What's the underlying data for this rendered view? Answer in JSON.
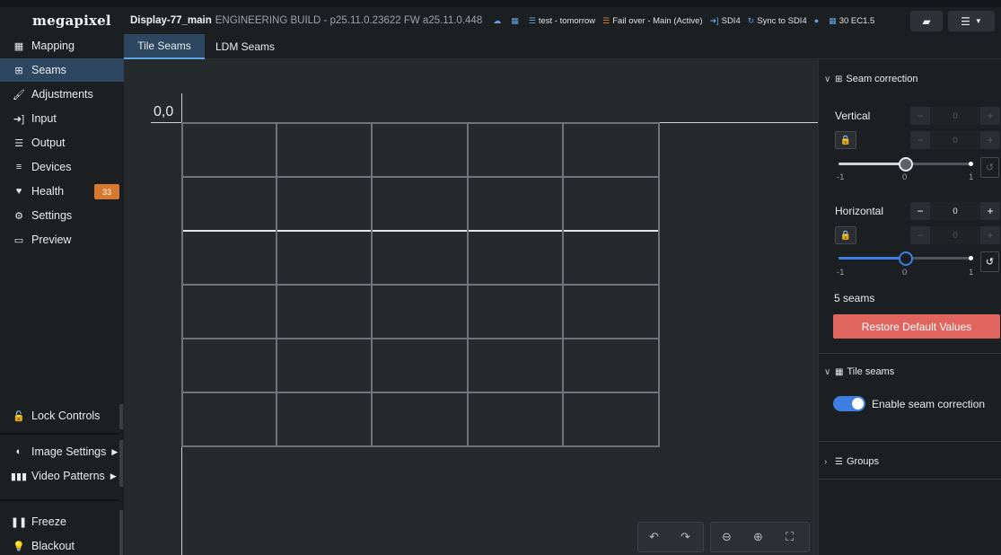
{
  "app": {
    "logo": "megapixel",
    "display_name": "Display-77_main",
    "build": "ENGINEERING BUILD - p25.11.0.23622 FW a25.11.0.448"
  },
  "status": {
    "schedule": "test - tomorrow",
    "failover": "Fail over - Main (Active)",
    "input": "SDI4",
    "sync": "Sync to SDI4",
    "framerate": "30 EC1.5"
  },
  "sidebar": {
    "items": [
      {
        "label": "Mapping",
        "icon": "grid-icon"
      },
      {
        "label": "Seams",
        "icon": "plus-box-icon"
      },
      {
        "label": "Adjustments",
        "icon": "brush-icon"
      },
      {
        "label": "Input",
        "icon": "input-icon"
      },
      {
        "label": "Output",
        "icon": "sliders-icon"
      },
      {
        "label": "Devices",
        "icon": "list-icon"
      },
      {
        "label": "Health",
        "icon": "heart-pulse-icon",
        "badge": "33"
      },
      {
        "label": "Settings",
        "icon": "gears-icon"
      },
      {
        "label": "Preview",
        "icon": "monitor-icon"
      }
    ],
    "lock_controls": "Lock Controls",
    "image_settings": "Image Settings",
    "video_patterns": "Video Patterns",
    "freeze": "Freeze",
    "blackout": "Blackout"
  },
  "tabs": {
    "tile_seams": "Tile Seams",
    "ldm_seams": "LDM Seams"
  },
  "canvas": {
    "origin_label": "0,0"
  },
  "panel": {
    "seam_correction": {
      "title": "Seam correction",
      "vertical_label": "Vertical",
      "vertical_value": "0",
      "vertical_locked_value": "0",
      "vertical_slider": {
        "min": "-1",
        "mid": "0",
        "max": "1",
        "value": 0
      },
      "horizontal_label": "Horizontal",
      "horizontal_value": "0",
      "horizontal_locked_value": "0",
      "horizontal_slider": {
        "min": "-1",
        "mid": "0",
        "max": "1",
        "value": 0
      },
      "seams_count": "5 seams",
      "restore_button": "Restore Default Values"
    },
    "tile_seams": {
      "title": "Tile seams",
      "enable_label": "Enable seam correction",
      "enabled": true
    },
    "groups": {
      "title": "Groups"
    }
  },
  "colors": {
    "accent_blue": "#3d7ee0",
    "active_nav": "#2d4761",
    "badge_orange": "#d6782f",
    "restore_red": "#e1655f"
  }
}
